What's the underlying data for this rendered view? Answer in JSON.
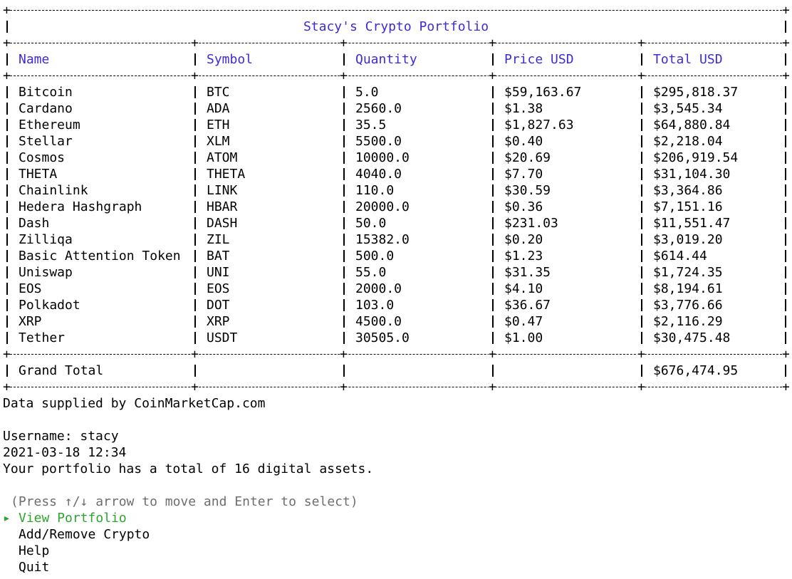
{
  "table": {
    "title": "Stacy's Crypto Portfolio",
    "columns": [
      "Name",
      "Symbol",
      "Quantity",
      "Price USD",
      "Total USD"
    ],
    "rows": [
      [
        "Bitcoin",
        "BTC",
        "5.0",
        "$59,163.67",
        "$295,818.37"
      ],
      [
        "Cardano",
        "ADA",
        "2560.0",
        "$1.38",
        "$3,545.34"
      ],
      [
        "Ethereum",
        "ETH",
        "35.5",
        "$1,827.63",
        "$64,880.84"
      ],
      [
        "Stellar",
        "XLM",
        "5500.0",
        "$0.40",
        "$2,218.04"
      ],
      [
        "Cosmos",
        "ATOM",
        "10000.0",
        "$20.69",
        "$206,919.54"
      ],
      [
        "THETA",
        "THETA",
        "4040.0",
        "$7.70",
        "$31,104.30"
      ],
      [
        "Chainlink",
        "LINK",
        "110.0",
        "$30.59",
        "$3,364.86"
      ],
      [
        "Hedera Hashgraph",
        "HBAR",
        "20000.0",
        "$0.36",
        "$7,151.16"
      ],
      [
        "Dash",
        "DASH",
        "50.0",
        "$231.03",
        "$11,551.47"
      ],
      [
        "Zilliqa",
        "ZIL",
        "15382.0",
        "$0.20",
        "$3,019.20"
      ],
      [
        "Basic Attention Token",
        "BAT",
        "500.0",
        "$1.23",
        "$614.44"
      ],
      [
        "Uniswap",
        "UNI",
        "55.0",
        "$31.35",
        "$1,724.35"
      ],
      [
        "EOS",
        "EOS",
        "2000.0",
        "$4.10",
        "$8,194.61"
      ],
      [
        "Polkadot",
        "DOT",
        "103.0",
        "$36.67",
        "$3,776.66"
      ],
      [
        "XRP",
        "XRP",
        "4500.0",
        "$0.47",
        "$2,116.29"
      ],
      [
        "Tether",
        "USDT",
        "30505.0",
        "$1.00",
        "$30,475.48"
      ]
    ],
    "grand_total": {
      "label": "Grand Total",
      "value": "$676,474.95"
    }
  },
  "footer": {
    "source": "Data supplied by CoinMarketCap.com",
    "username": "Username: stacy",
    "datetime": "2021-03-18 12:34",
    "summary": "Your portfolio has a total of 16 digital assets."
  },
  "menu": {
    "hint": "(Press ↑/↓ arrow to move and Enter to select)",
    "pointer": "▸",
    "items": [
      "View Portfolio",
      "Add/Remove Crypto",
      "Help",
      "Quit"
    ],
    "selected_index": 0
  },
  "colors": {
    "header": "#3b2bd8",
    "selected": "#2fa52f",
    "hint": "#6e6e6e"
  }
}
